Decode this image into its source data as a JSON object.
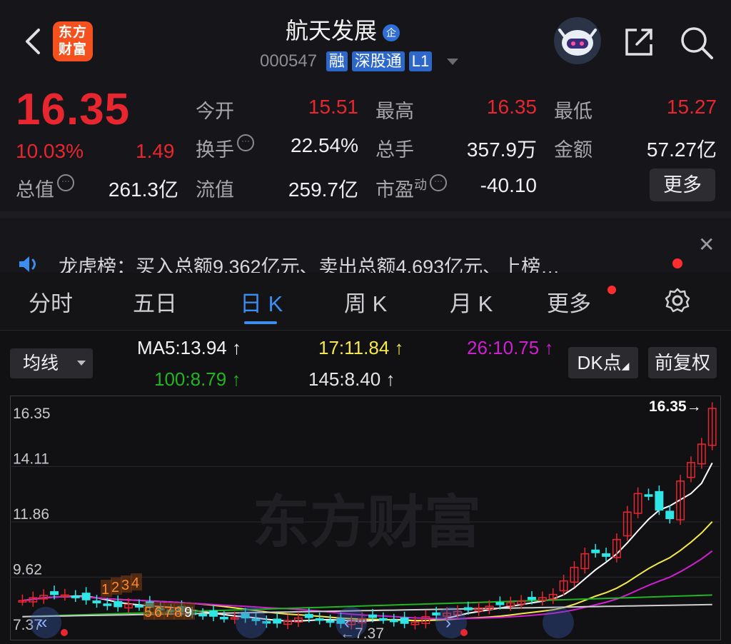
{
  "header": {
    "logo_line1": "东方",
    "logo_line2": "财富",
    "stock_name": "航天发展",
    "name_badge": "企",
    "code": "000547",
    "tags": [
      "融",
      "深股通",
      "L1"
    ]
  },
  "quote": {
    "price": "16.35",
    "change_pct": "10.03%",
    "change": "1.49",
    "rows": [
      [
        {
          "label": "今开",
          "value": "15.51",
          "red": true
        },
        {
          "label": "最高",
          "value": "16.35",
          "red": true
        },
        {
          "label": "最低",
          "value": "15.27",
          "red": true
        }
      ],
      [
        {
          "label": "换手",
          "value": "22.54%",
          "info": true
        },
        {
          "label": "总手",
          "value": "357.9万"
        },
        {
          "label": "金额",
          "value": "57.27亿"
        }
      ]
    ],
    "total_value_label": "总值",
    "total_value": "261.3亿",
    "float_value_label": "流值",
    "float_value": "259.7亿",
    "pe_label": "市盈",
    "pe_sup": "动",
    "pe_value": "-40.10",
    "more_label": "更多"
  },
  "news": {
    "text": "龙虎榜：买入总额9.362亿元、卖出总额4.693亿元、上榜…"
  },
  "tabs": [
    "分时",
    "五日",
    "日 K",
    "周 K",
    "月 K",
    "更多"
  ],
  "active_tab": "日 K",
  "ma_bar": {
    "select_label": "均线",
    "ma5": "MA5:13.94",
    "ma17": "17:11.84",
    "ma26": "26:10.75",
    "ma100": "100:8.79",
    "ma145": "145:8.40",
    "dk_label": "DK点",
    "fq_label": "前复权"
  },
  "colors": {
    "up": "#e8262f",
    "down": "#2ee6e6",
    "ma5": "#ffffff",
    "ma17": "#f5e84a",
    "ma26": "#d01fd0",
    "ma100": "#22b422",
    "ma145": "#cfcfcf",
    "accent": "#3b8df0"
  },
  "chart_data": {
    "type": "candlestick",
    "title": "",
    "y_ticks": [
      "16.35",
      "14.11",
      "11.86",
      "9.62",
      "7.37"
    ],
    "ylim": [
      7.37,
      16.35
    ],
    "last_price_label": "16.35",
    "low_marker_label": "7.37",
    "sequence_labels_orange": [
      "1",
      "2",
      "3",
      "4",
      "5",
      "6",
      "7",
      "8",
      "9"
    ],
    "watermark": "东方财富",
    "series": [
      {
        "name": "MA5",
        "last": 13.94
      },
      {
        "name": "MA17",
        "last": 11.84
      },
      {
        "name": "MA26",
        "last": 10.75
      },
      {
        "name": "MA100",
        "last": 8.79
      },
      {
        "name": "MA145",
        "last": 8.4
      }
    ]
  }
}
